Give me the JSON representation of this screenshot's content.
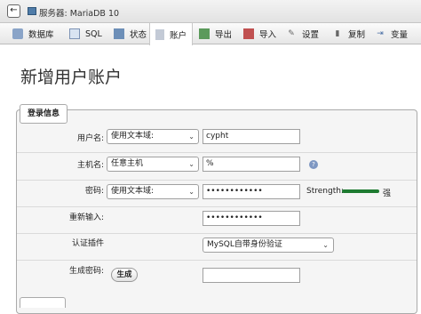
{
  "topbar": {
    "back_glyph": "←",
    "server_label": "服务器: MariaDB 10"
  },
  "tabs": [
    {
      "label": "数据库",
      "icon": "database-icon"
    },
    {
      "label": "SQL",
      "icon": "sql-icon"
    },
    {
      "label": "状态",
      "icon": "status-icon"
    },
    {
      "label": "账户",
      "icon": "accounts-icon",
      "active": true
    },
    {
      "label": "导出",
      "icon": "export-icon"
    },
    {
      "label": "导入",
      "icon": "import-icon"
    },
    {
      "label": "设置",
      "icon": "settings-icon"
    },
    {
      "label": "复制",
      "icon": "replication-icon"
    },
    {
      "label": "变量",
      "icon": "variables-icon"
    }
  ],
  "page": {
    "title": "新增用户账户",
    "legend": "登录信息"
  },
  "form": {
    "username": {
      "label": "用户名:",
      "select": "使用文本域:",
      "value": "cypht"
    },
    "host": {
      "label": "主机名:",
      "select": "任意主机",
      "value": "%"
    },
    "password": {
      "label": "密码:",
      "select": "使用文本域:",
      "value": "••••••••••••"
    },
    "strength": {
      "label": "Strength:",
      "text": "强",
      "color": "#1e7b31"
    },
    "reenter": {
      "label": "重新输入:",
      "value": "••••••••••••"
    },
    "auth_plugin": {
      "label": "认证插件",
      "value": "MySQL自带身份验证"
    },
    "generate": {
      "label": "生成密码:",
      "button": "生成",
      "value": ""
    }
  }
}
